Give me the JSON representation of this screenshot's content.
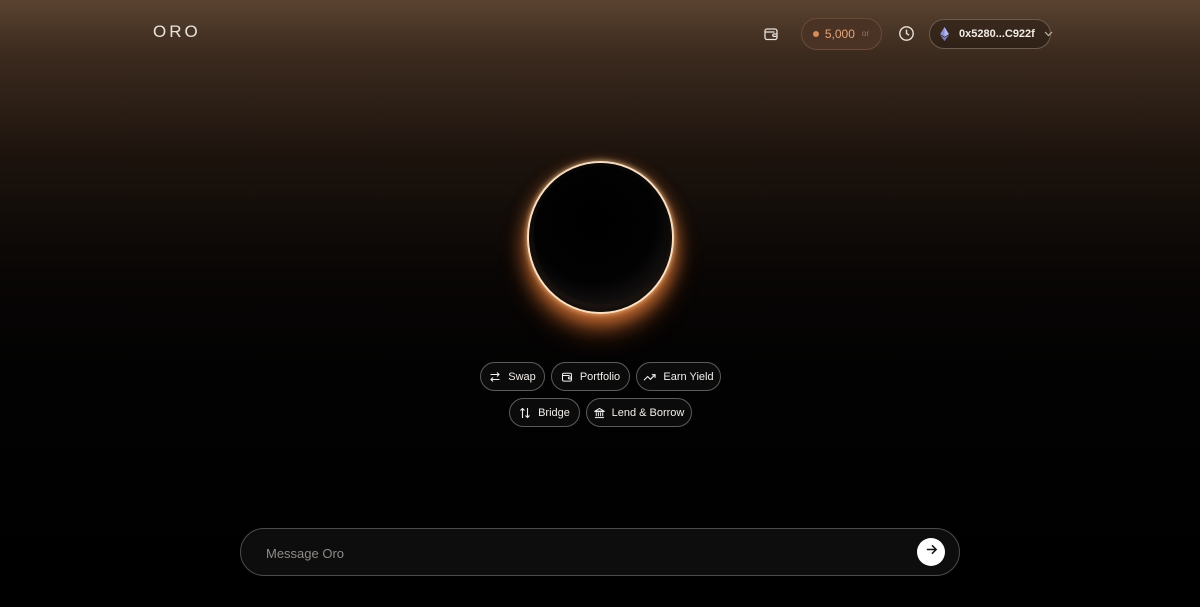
{
  "header": {
    "logo": "ORO",
    "points": {
      "value": "5,000",
      "unit": "or"
    },
    "wallet": {
      "address": "0x5280...C922f",
      "network_icon": "ethereum-icon"
    },
    "icons": [
      "wallet-icon",
      "history-clock-icon",
      "ethereum-icon",
      "chevron-down-icon"
    ]
  },
  "actions": [
    {
      "label": "Swap",
      "icon": "swap-arrows-icon"
    },
    {
      "label": "Portfolio",
      "icon": "wallet-icon"
    },
    {
      "label": "Earn Yield",
      "icon": "trending-up-icon"
    },
    {
      "label": "Bridge",
      "icon": "up-down-arrows-icon"
    },
    {
      "label": "Lend & Borrow",
      "icon": "bank-icon"
    }
  ],
  "composer": {
    "placeholder": "Message Oro",
    "send_icon": "arrow-right-icon"
  },
  "colors": {
    "accent_orange": "#d98b5c",
    "points_pill_bg": "#4a3224",
    "send_button_bg": "#ffffff"
  }
}
